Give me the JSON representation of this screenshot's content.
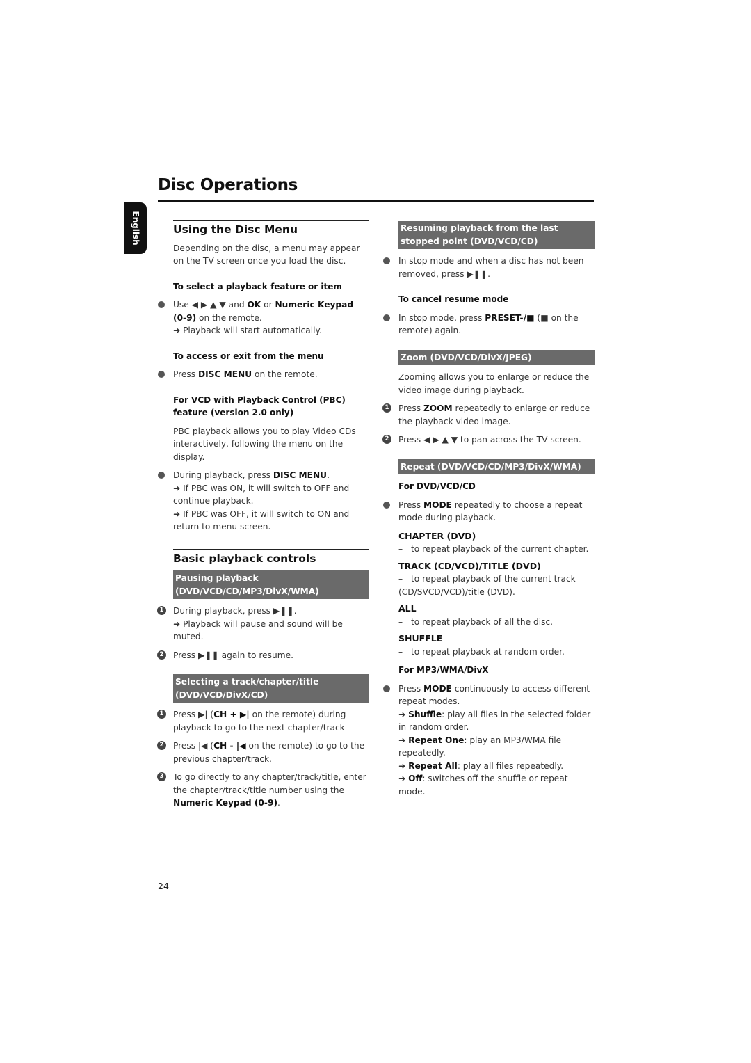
{
  "page": {
    "title": "Disc Operations",
    "language_tab": "English",
    "page_number": "24"
  },
  "left": {
    "disc_menu": {
      "heading": "Using the Disc Menu",
      "intro": "Depending on the disc, a menu may appear on the TV screen once you load the disc.",
      "select_sub": "To select a playback feature or item",
      "select_bullet_pre": "Use ◀ ▶ ▲ ▼ and ",
      "select_ok": "OK",
      "select_or": " or ",
      "select_keypad": "Numeric Keypad (0-9)",
      "select_post": " on the remote.",
      "select_result": "➜ Playback will start automatically.",
      "access_sub": "To access or exit from the menu",
      "access_pre": "Press ",
      "access_key": "DISC MENU",
      "access_post": " on the remote.",
      "pbc_sub": "For VCD with Playback Control (PBC) feature (version 2.0 only)",
      "pbc_intro": "PBC playback allows you to play Video CDs interactively, following the menu on the display.",
      "pbc_bullet_pre": "During playback, press ",
      "pbc_bullet_key": "DISC MENU",
      "pbc_bullet_post": ".",
      "pbc_result1": "➜ If PBC was ON, it will switch to OFF and continue playback.",
      "pbc_result2": "➜ If PBC was OFF, it will switch to ON and return to menu screen."
    },
    "basic": {
      "heading": "Basic playback controls",
      "pause_bar": "Pausing playback (DVD/VCD/CD/MP3/DivX/WMA)",
      "pause_step1": "During playback, press ▶❚❚.",
      "pause_step1_result": "➜ Playback will pause and sound will be muted.",
      "pause_step2": "Press ▶❚❚ again to resume.",
      "select_bar": "Selecting a track/chapter/title (DVD/VCD/DivX/CD)",
      "sel_step1_pre": "Press ▶| (",
      "sel_step1_key": "CH + ▶|",
      "sel_step1_post": " on the remote) during playback to go to the next chapter/track",
      "sel_step2_pre": "Press |◀ (",
      "sel_step2_key": "CH - |◀",
      "sel_step2_post": " on the remote) to go to the previous chapter/track.",
      "sel_step3_pre": "To go directly to any chapter/track/title, enter the chapter/track/title number using the ",
      "sel_step3_key": "Numeric Keypad (0-9)",
      "sel_step3_post": ".",
      "step_numbers": [
        "1",
        "2",
        "3"
      ]
    }
  },
  "right": {
    "resume": {
      "bar": "Resuming playback from the last stopped point (DVD/VCD/CD)",
      "bullet": "In stop mode and when a disc has not been removed, press ▶❚❚.",
      "cancel_sub": "To cancel resume mode",
      "cancel_pre": "In stop mode, press ",
      "cancel_key": "PRESET-/■",
      "cancel_post": " (■ on the remote) again."
    },
    "zoom": {
      "bar": "Zoom (DVD/VCD/DivX/JPEG)",
      "intro": "Zooming allows you to enlarge or reduce the video image during playback.",
      "step1_pre": "Press ",
      "step1_key": "ZOOM",
      "step1_post": " repeatedly to enlarge or reduce the playback video image.",
      "step2": "Press ◀ ▶ ▲ ▼ to pan across the TV screen."
    },
    "repeat": {
      "bar": "Repeat (DVD/VCD/CD/MP3/DivX/WMA)",
      "dvd_sub": "For DVD/VCD/CD",
      "dvd_pre": "Press ",
      "dvd_key": "MODE",
      "dvd_post": " repeatedly to choose a repeat mode during playback.",
      "modes": [
        {
          "name": "CHAPTER (DVD)",
          "desc": "to repeat playback of the current chapter."
        },
        {
          "name": "TRACK (CD/VCD)/TITLE (DVD)",
          "desc": "to repeat playback of the current track (CD/SVCD/VCD)/title (DVD)."
        },
        {
          "name": "ALL",
          "desc": "to repeat playback of all the disc."
        },
        {
          "name": "SHUFFLE",
          "desc": "to repeat playback at random order."
        }
      ],
      "mp3_sub": "For MP3/WMA/DivX",
      "mp3_pre": "Press ",
      "mp3_key": "MODE",
      "mp3_post": " continuously to access different repeat modes.",
      "mp3_options": [
        {
          "name": "Shuffle",
          "desc": ": play all files in the selected folder in random order."
        },
        {
          "name": "Repeat One",
          "desc": ": play an MP3/WMA file repeatedly."
        },
        {
          "name": "Repeat All",
          "desc": ": play all files repeatedly."
        },
        {
          "name": "Off",
          "desc": ": switches off the shuffle or repeat mode."
        }
      ],
      "dash": "–",
      "arrow": "➜ "
    }
  }
}
